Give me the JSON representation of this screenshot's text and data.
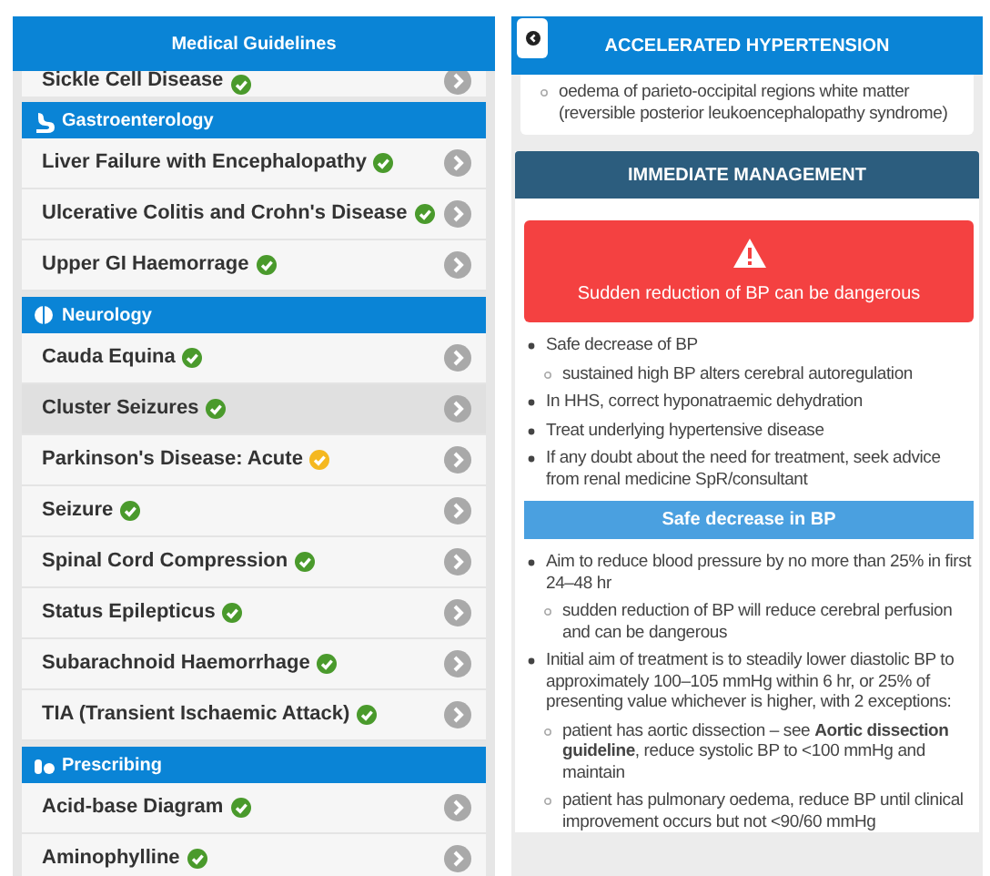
{
  "left": {
    "title": "Medical Guidelines",
    "entries": [
      {
        "kind": "cut_item",
        "label": "Sickle Cell Disease",
        "color": "#4a9a2c",
        "selected": false
      },
      {
        "kind": "header",
        "label": "Gastroenterology"
      },
      {
        "kind": "item",
        "label": "Liver Failure with Encephalopathy",
        "color": "#4a9a2c",
        "selected": false
      },
      {
        "kind": "item",
        "label": "Ulcerative Colitis and Crohn's Disease",
        "color": "#4a9a2c",
        "selected": false
      },
      {
        "kind": "item",
        "label": "Upper GI Haemorrage",
        "color": "#4a9a2c",
        "selected": false
      },
      {
        "kind": "header",
        "label": "Neurology"
      },
      {
        "kind": "item",
        "label": "Cauda Equina",
        "color": "#4a9a2c",
        "selected": false
      },
      {
        "kind": "item",
        "label": "Cluster Seizures",
        "color": "#4a9a2c",
        "selected": true
      },
      {
        "kind": "item",
        "label": "Parkinson's Disease: Acute",
        "color": "#f5b820",
        "selected": false
      },
      {
        "kind": "item",
        "label": "Seizure",
        "color": "#4a9a2c",
        "selected": false
      },
      {
        "kind": "item",
        "label": "Spinal Cord Compression",
        "color": "#4a9a2c",
        "selected": false
      },
      {
        "kind": "item",
        "label": "Status Epilepticus",
        "color": "#4a9a2c",
        "selected": false
      },
      {
        "kind": "item",
        "label": "Subarachnoid Haemorrhage",
        "color": "#4a9a2c",
        "selected": false
      },
      {
        "kind": "item",
        "label": "TIA (Transient Ischaemic Attack)",
        "color": "#4a9a2c",
        "selected": false
      },
      {
        "kind": "header",
        "label": "Prescribing"
      },
      {
        "kind": "item",
        "label": "Acid-base Diagram",
        "color": "#4a9a2c",
        "selected": false
      },
      {
        "kind": "item",
        "label": "Aminophylline",
        "color": "#4a9a2c",
        "selected": false
      }
    ]
  },
  "right": {
    "title": "ACCELERATED HYPERTENSION",
    "intro_subitems": [
      "oedema of parieto-occipital regions white matter (reversible posterior leukoencephalopathy syndrome)"
    ],
    "section": {
      "heading": "IMMEDIATE MANAGEMENT",
      "alert": "Sudden reduction of BP can be dangerous",
      "bullets": [
        {
          "text": "Safe decrease of BP",
          "children": [
            {
              "text": "sustained high BP alters cerebral autoregulation"
            }
          ]
        },
        {
          "text": "In HHS, correct hyponatraemic dehydration"
        },
        {
          "text": "Treat underlying hypertensive disease"
        },
        {
          "text": "If any doubt about the need for treatment, seek advice from renal medicine SpR/consultant"
        }
      ],
      "subheading": "Safe decrease in BP",
      "sub_bullets": [
        {
          "text": "Aim to reduce blood pressure by no more than 25% in first 24–48 hr",
          "children": [
            {
              "text": "sudden reduction of BP will reduce cerebral perfusion and can be dangerous"
            }
          ]
        },
        {
          "text": "Initial aim of treatment is to steadily lower diastolic BP to approximately 100–105 mmHg within 6 hr, or 25% of presenting value whichever is higher, with 2 exceptions:",
          "children": [
            {
              "text": "patient has aortic dissection – see **Aortic dissection guideline**, reduce systolic BP to <100 mmHg and maintain"
            },
            {
              "text": "patient has pulmonary oedema, reduce BP until clinical improvement occurs but not <90/60 mmHg"
            }
          ]
        }
      ]
    }
  }
}
